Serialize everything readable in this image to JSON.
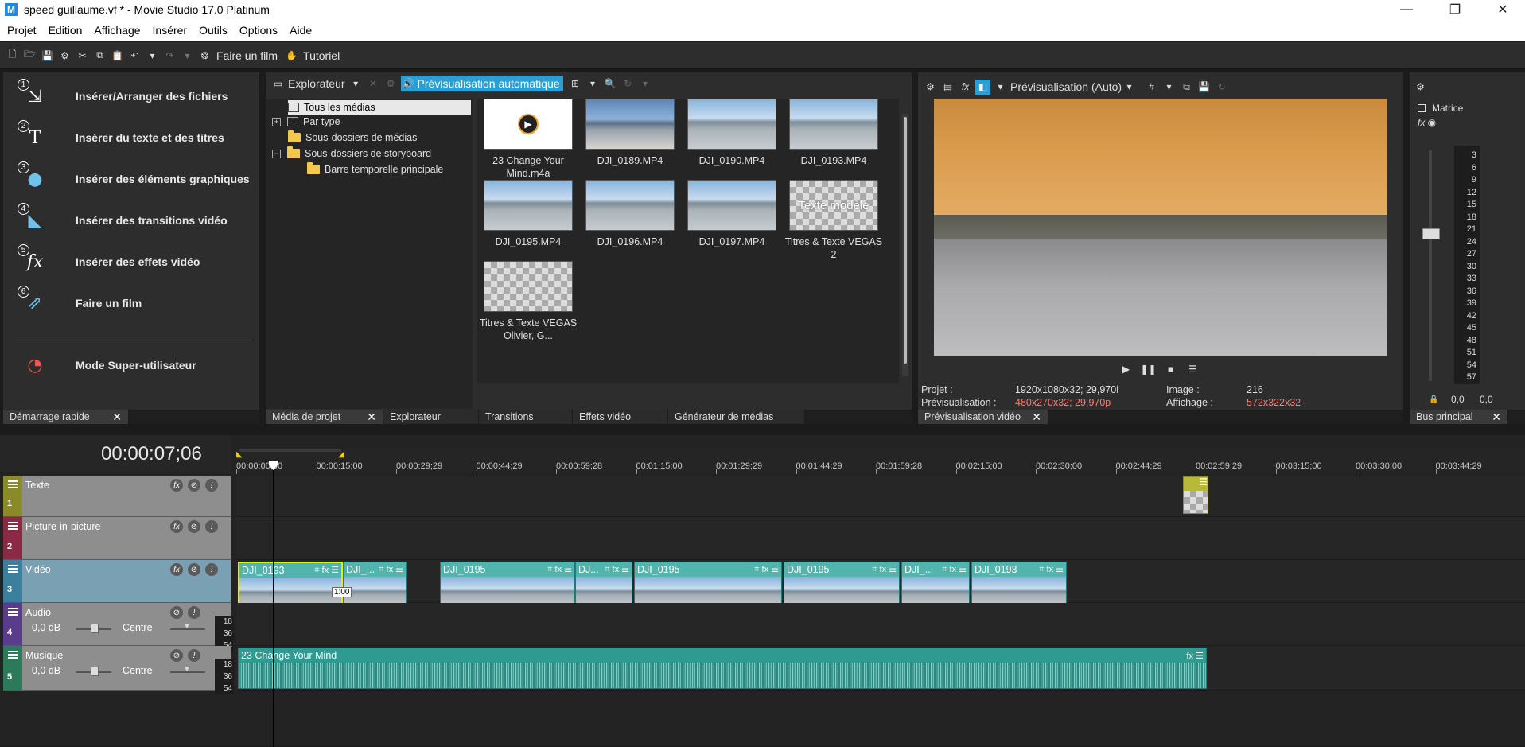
{
  "window": {
    "title": "speed guillaume.vf * - Movie Studio 17.0 Platinum",
    "app_icon": "M",
    "minimize": "—",
    "maximize": "❐",
    "close": "✕"
  },
  "menu": [
    "Projet",
    "Edition",
    "Affichage",
    "Insérer",
    "Outils",
    "Options",
    "Aide"
  ],
  "toolbar": {
    "make_movie": "Faire un film",
    "tutorial": "Tutoriel"
  },
  "quickstart": {
    "items": [
      {
        "num": "1",
        "label": "Insérer/Arranger des fichiers"
      },
      {
        "num": "2",
        "label": "Insérer du texte et des titres"
      },
      {
        "num": "3",
        "label": "Insérer des éléments graphiques"
      },
      {
        "num": "4",
        "label": "Insérer des transitions vidéo"
      },
      {
        "num": "5",
        "label": "Insérer des effets vidéo"
      },
      {
        "num": "6",
        "label": "Faire un film"
      }
    ],
    "super_user": "Mode Super-utilisateur",
    "tab": "Démarrage rapide"
  },
  "explorer": {
    "dropdown": "Explorateur",
    "auto_preview": "Prévisualisation automatique",
    "tree": [
      "Tous les médias",
      "Par type",
      "Sous-dossiers de médias",
      "Sous-dossiers de storyboard",
      "Barre temporelle principale"
    ],
    "thumbs": [
      {
        "label": "23 Change Your Mind.m4a"
      },
      {
        "label": "DJI_0189.MP4"
      },
      {
        "label": "DJI_0190.MP4"
      },
      {
        "label": "DJI_0193.MP4"
      },
      {
        "label": "DJI_0195.MP4"
      },
      {
        "label": "DJI_0196.MP4"
      },
      {
        "label": "DJI_0197.MP4"
      },
      {
        "label": "Titres & Texte VEGAS 2",
        "overlay": "Texte modèle"
      },
      {
        "label": "Titres & Texte VEGAS Olivier, G..."
      }
    ],
    "tabs": [
      "Média de projet",
      "Explorateur",
      "Transitions",
      "Effets vidéo",
      "Générateur de médias"
    ]
  },
  "preview": {
    "mode": "Prévisualisation (Auto)",
    "projet_label": "Projet :",
    "projet_value": "1920x1080x32; 29,970i",
    "prev_label": "Prévisualisation :",
    "prev_value": "480x270x32; 29,970p",
    "image_label": "Image :",
    "image_value": "216",
    "display_label": "Affichage :",
    "display_value": "572x322x32",
    "tab": "Prévisualisation vidéo",
    "warn_color": "#ff7b6b"
  },
  "bus": {
    "matrix": "Matrice",
    "scale": [
      "3",
      "6",
      "9",
      "12",
      "15",
      "18",
      "21",
      "24",
      "27",
      "30",
      "33",
      "36",
      "39",
      "42",
      "45",
      "48",
      "51",
      "54",
      "57"
    ],
    "left": "0,0",
    "right": "0,0",
    "tab": "Bus principal"
  },
  "timeline": {
    "timecode": "00:00:07;06",
    "ruler": [
      "00:00:00;00",
      "00:00:15;00",
      "00:00:29;29",
      "00:00:44;29",
      "00:00:59;28",
      "00:01:15;00",
      "00:01:29;29",
      "00:01:44;29",
      "00:01:59;28",
      "00:02:15;00",
      "00:02:30;00",
      "00:02:44;29",
      "00:02:59;29",
      "00:03:15;00",
      "00:03:30;00",
      "00:03:44;29"
    ],
    "tracks": [
      {
        "num": "1",
        "name": "Texte",
        "color": "#8a8a2a"
      },
      {
        "num": "2",
        "name": "Picture-in-picture",
        "color": "#8a2a44"
      },
      {
        "num": "3",
        "name": "Vidéo",
        "color": "#3c7f9c"
      },
      {
        "num": "4",
        "name": "Audio",
        "color": "#5a3d8a",
        "vol": "0,0 dB",
        "pan": "Centre",
        "meter": [
          "18",
          "36",
          "54"
        ]
      },
      {
        "num": "5",
        "name": "Musique",
        "color": "#2d7a5a",
        "vol": "0,0 dB",
        "pan": "Centre",
        "meter": [
          "18",
          "36",
          "54"
        ]
      }
    ],
    "video_clips": [
      "DJI_0193",
      "DJI_...",
      "DJI_0195",
      "DJ...",
      "DJI_0195",
      "DJI_0195",
      "DJI_...",
      "DJI_0193"
    ],
    "fade_label": "1:00",
    "music_clip": "23 Change Your Mind"
  }
}
